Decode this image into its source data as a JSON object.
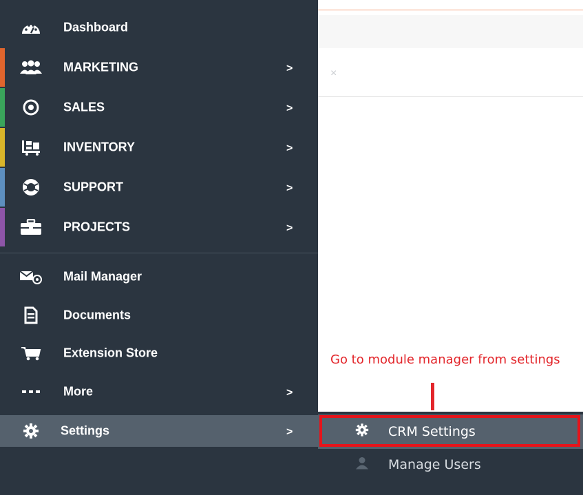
{
  "sidebar": {
    "items": [
      {
        "label": "Dashboard",
        "icon": "dashboard-gauge-icon",
        "has_submenu": false,
        "accent": ""
      },
      {
        "label": "MARKETING",
        "icon": "users-group-icon",
        "has_submenu": true,
        "accent": "#e0652d"
      },
      {
        "label": "SALES",
        "icon": "target-icon",
        "has_submenu": true,
        "accent": "#3aa55b"
      },
      {
        "label": "INVENTORY",
        "icon": "inventory-cart-icon",
        "has_submenu": true,
        "accent": "#d9b52a"
      },
      {
        "label": "SUPPORT",
        "icon": "lifebuoy-icon",
        "has_submenu": true,
        "accent": "#5d8fbf"
      },
      {
        "label": "PROJECTS",
        "icon": "briefcase-icon",
        "has_submenu": true,
        "accent": "#8e55a8"
      },
      {
        "label": "Mail Manager",
        "icon": "mail-at-icon",
        "has_submenu": false,
        "accent": ""
      },
      {
        "label": "Documents",
        "icon": "document-icon",
        "has_submenu": false,
        "accent": ""
      },
      {
        "label": "Extension Store",
        "icon": "cart-icon",
        "has_submenu": false,
        "accent": ""
      },
      {
        "label": "More",
        "icon": "ellipsis-icon",
        "has_submenu": true,
        "accent": ""
      },
      {
        "label": "Settings",
        "icon": "gear-icon",
        "has_submenu": true,
        "accent": ""
      }
    ],
    "chevron": ">"
  },
  "main": {
    "close_glyph": "×"
  },
  "annotation": {
    "text": "Go to module manager from settings"
  },
  "submenu": {
    "items": [
      {
        "label": "CRM Settings",
        "icon": "gear-icon",
        "highlighted": true
      },
      {
        "label": "Manage Users",
        "icon": "user-icon",
        "highlighted": false
      }
    ]
  },
  "colors": {
    "sidebar_bg": "#2b3540",
    "settings_active_bg": "#55616d",
    "annotation_red": "#e3262b"
  }
}
